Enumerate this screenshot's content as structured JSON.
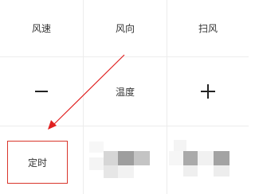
{
  "row1": {
    "wind_speed_label": "风速",
    "wind_direction_label": "风向",
    "swing_label": "扫风"
  },
  "row2": {
    "temperature_label": "温度"
  },
  "row3": {
    "timer_label": "定时"
  },
  "colors": {
    "highlight_border": "#d9352b",
    "annotation_arrow": "#e02020",
    "divider": "#ececec",
    "text": "#333333"
  },
  "icons": {
    "decrease": "minus-icon",
    "increase": "plus-icon",
    "annotation": "arrow-annotation"
  }
}
